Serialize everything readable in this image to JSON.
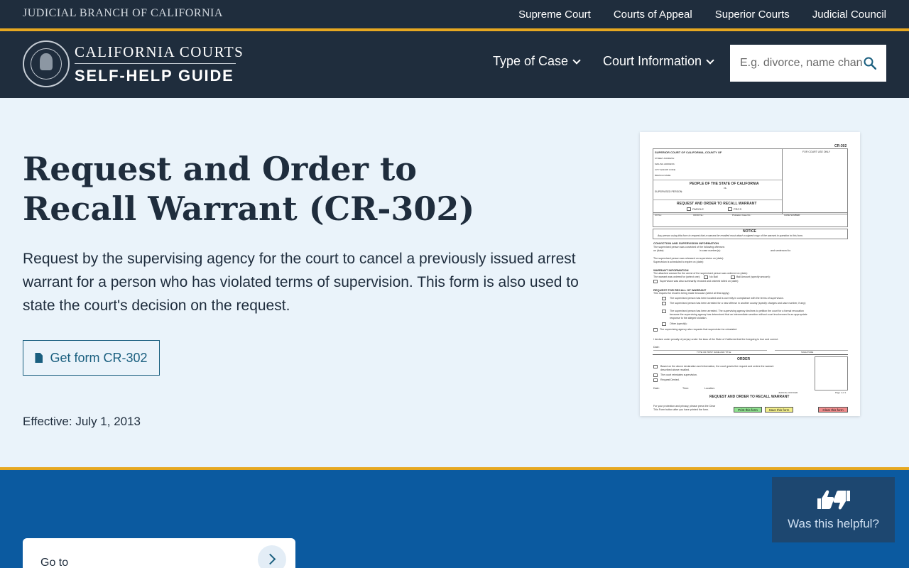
{
  "topbar": {
    "brand": "JUDICIAL BRANCH OF CALIFORNIA",
    "links": [
      "Supreme Court",
      "Courts of Appeal",
      "Superior Courts",
      "Judicial Council"
    ]
  },
  "header": {
    "logo_line1": "CALIFORNIA COURTS",
    "logo_line2": "SELF-HELP GUIDE",
    "nav": [
      "Type of Case",
      "Court Information"
    ],
    "search_placeholder": "E.g. divorce, name change, ..."
  },
  "main": {
    "title": "Request and Order to Recall Warrant (CR-302)",
    "description": "Request by the supervising agency for the court to cancel a previously issued arrest warrant for a person who has violated terms of supervision. This form is also used to state the court's decision on the request.",
    "get_form_label": "Get form CR-302",
    "effective": "Effective: July 1, 2013"
  },
  "form_preview": {
    "code": "CR-302",
    "court_header": "SUPERIOR COURT OF CALIFORNIA, COUNTY OF",
    "court_use": "FOR COURT USE ONLY",
    "address_lines": [
      "STREET ADDRESS:",
      "MAILING ADDRESS:",
      "CITY AND ZIP CODE:",
      "BRANCH NAME:"
    ],
    "people": "PEOPLE OF THE STATE OF CALIFORNIA",
    "vs": "vs.",
    "supervised": "SUPERVISED PERSON:",
    "form_title": "REQUEST AND ORDER TO RECALL WARRANT",
    "parole": "PAROLE",
    "prcs": "PRCS",
    "fields": [
      "CII No.:",
      "CDCR No.:",
      "Probation Case No.:",
      "CASE NUMBER:"
    ],
    "notice": "NOTICE",
    "notice_text": "Any person using this form to request that a warrant be recalled must attach a signed copy of the warrant in question to this form.",
    "sections": {
      "conviction": "CONVICTION AND SUPERVISION INFORMATION",
      "warrant": "WARRANT INFORMATION",
      "request": "REQUEST FOR RECALL OF WARRANT",
      "order": "ORDER"
    },
    "lines": {
      "c1": "The supervised person was convicted of the following offenses:",
      "c2": "on (date):",
      "c3": "in case number(s):",
      "c4": "and sentenced to:",
      "c5": "The supervised person was released on supervision on (date):",
      "c6": "Supervision is scheduled to expire on (date):",
      "w1": "The attached warrant for the arrest of the supervised person was ordered on (date):",
      "w2": "The warrant was ordered for (select one):",
      "w2a": "No Bail",
      "w2b": "Bail Amount (specify amount):",
      "w3": "Supervision was also summarily revoked and ordered tolled on (date):",
      "r0": "This request for recall is being made because (select all that apply):",
      "r1": "The supervised person has been located and is currently in compliance with the terms of supervision.",
      "r2": "The supervised person has been arrested for a new offense in another county (specify charges and case number, if any):",
      "r3": "The supervised person has been arrested. The supervising agency declines to petition the court for a formal revocation",
      "r3b": "because the supervising agency has determined that an intermediate sanction without court involvement is an appropriate",
      "r3c": "response to the alleged violation.",
      "r4": "Other (specify):",
      "r5": "The supervising agency also requests that supervision be reinstated.",
      "decl": "I declare under penalty of perjury under the laws of the State of California that the foregoing is true and correct.",
      "date": "Date:",
      "sig1": "TYPE OR PRINT NAME AND TITLE",
      "sig2": "SIGNATURE",
      "o1": "Based on the above declaration and information, the court grants the request and orders the warrant",
      "o1b": "described above recalled.",
      "o2": "The court reinstates supervision.",
      "o3": "Request Denied.",
      "time": "Time:",
      "location": "Location:",
      "judicial": "JUDICIAL OFFICER",
      "page": "Page 1 of 1",
      "footer_title": "REQUEST AND ORDER TO RECALL WARRANT",
      "fine1": "For your protection and privacy, please press the Clear",
      "fine2": "This Form button after you have printed the form."
    },
    "buttons": {
      "print": "Print this form",
      "save": "Save this form",
      "clear": "Clear this form"
    }
  },
  "footer": {
    "goto_label": "Go to",
    "helpful_label": "Was this helpful?"
  }
}
